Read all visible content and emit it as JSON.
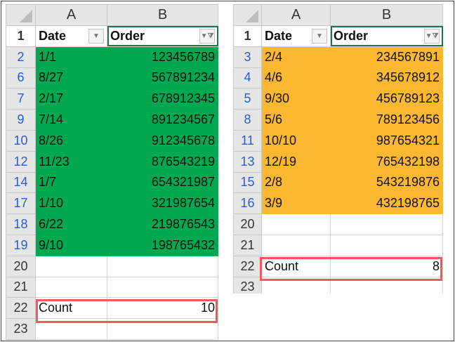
{
  "columns": [
    "A",
    "B"
  ],
  "header": {
    "date": "Date",
    "order": "Order",
    "row": "1"
  },
  "left": {
    "rows": [
      {
        "n": "2",
        "date": "1/1",
        "order": "123456789"
      },
      {
        "n": "6",
        "date": "8/27",
        "order": "567891234"
      },
      {
        "n": "7",
        "date": "2/17",
        "order": "678912345"
      },
      {
        "n": "9",
        "date": "7/14",
        "order": "891234567"
      },
      {
        "n": "10",
        "date": "8/26",
        "order": "912345678"
      },
      {
        "n": "12",
        "date": "11/23",
        "order": "876543219"
      },
      {
        "n": "14",
        "date": "1/7",
        "order": "654321987"
      },
      {
        "n": "17",
        "date": "1/10",
        "order": "321987654"
      },
      {
        "n": "18",
        "date": "6/22",
        "order": "219876543"
      },
      {
        "n": "19",
        "date": "9/10",
        "order": "198765432"
      }
    ],
    "empty": [
      "20",
      "21"
    ],
    "count": {
      "n": "22",
      "label": "Count",
      "value": "10"
    },
    "after": "23"
  },
  "right": {
    "rows": [
      {
        "n": "3",
        "date": "2/4",
        "order": "234567891"
      },
      {
        "n": "4",
        "date": "4/6",
        "order": "345678912"
      },
      {
        "n": "5",
        "date": "9/30",
        "order": "456789123"
      },
      {
        "n": "8",
        "date": "5/6",
        "order": "789123456"
      },
      {
        "n": "11",
        "date": "10/10",
        "order": "987654321"
      },
      {
        "n": "13",
        "date": "12/19",
        "order": "765432198"
      },
      {
        "n": "15",
        "date": "2/8",
        "order": "543219876"
      },
      {
        "n": "16",
        "date": "3/9",
        "order": "432198765"
      }
    ],
    "empty": [
      "20",
      "21"
    ],
    "count": {
      "n": "22",
      "label": "Count",
      "value": "8"
    },
    "after": "23"
  },
  "colors": {
    "green": "#00a94f",
    "orange": "#fbb830",
    "highlight": "#f25a5a"
  }
}
